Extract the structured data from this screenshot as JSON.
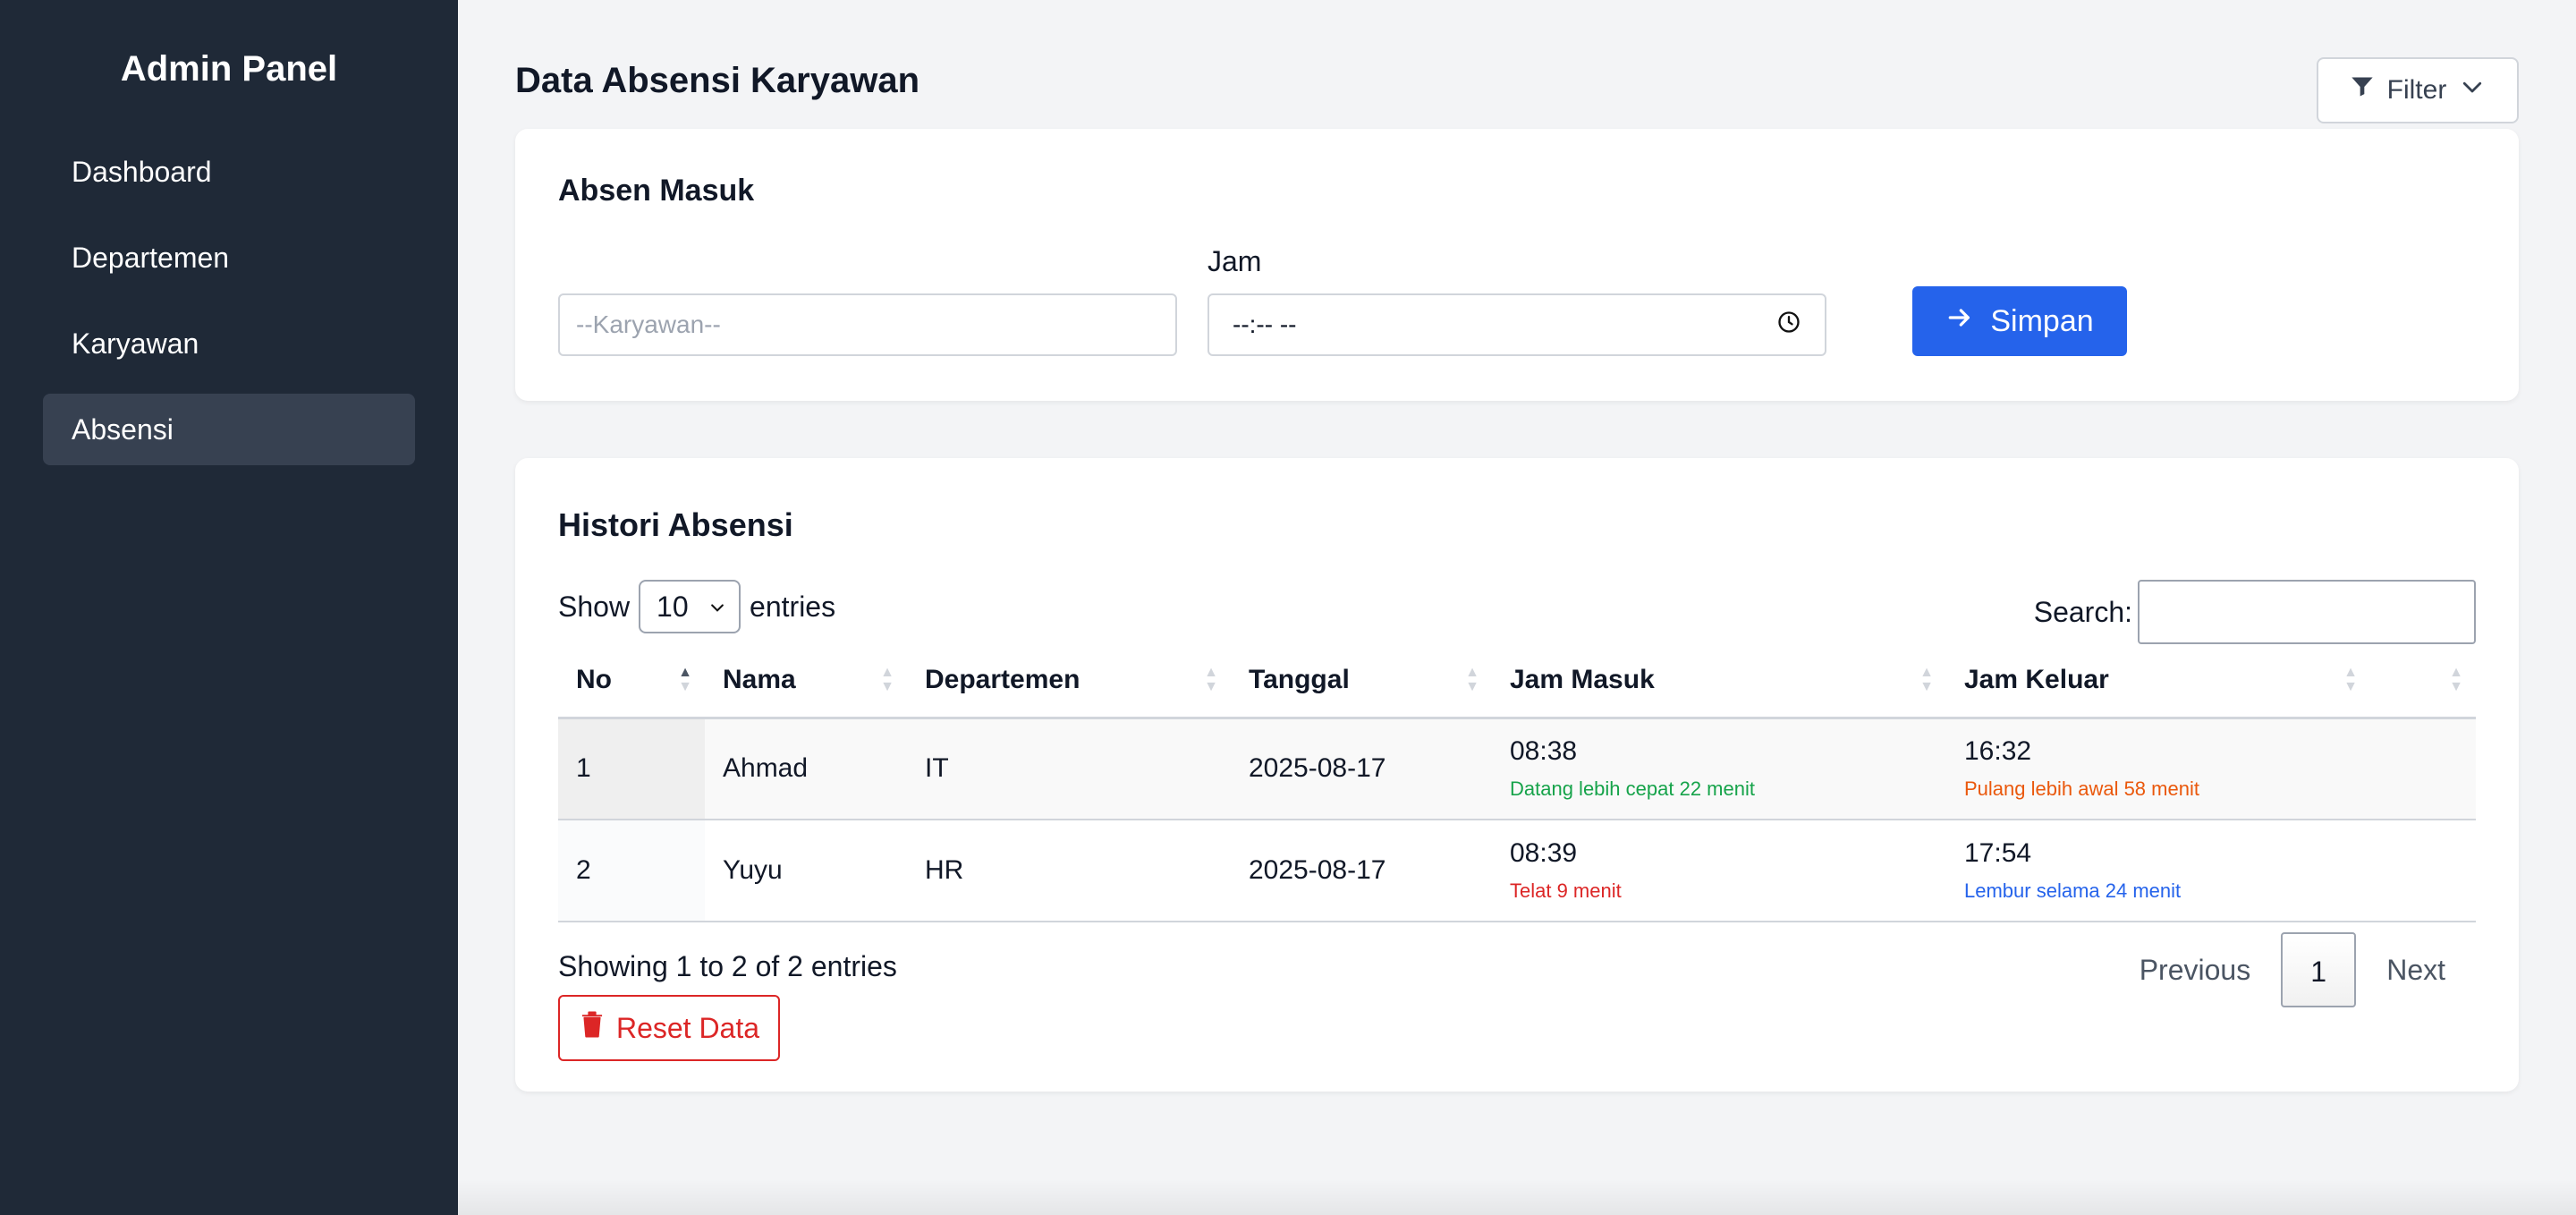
{
  "sidebar": {
    "brand": "Admin Panel",
    "items": [
      {
        "label": "Dashboard"
      },
      {
        "label": "Departemen"
      },
      {
        "label": "Karyawan"
      },
      {
        "label": "Absensi"
      }
    ]
  },
  "header": {
    "title": "Data Absensi Karyawan",
    "filter_label": "Filter"
  },
  "absen_masuk": {
    "title": "Absen Masuk",
    "employee_placeholder": "--Karyawan--",
    "time_label": "Jam",
    "time_value": "--:-- --",
    "submit_label": "Simpan"
  },
  "histori": {
    "title": "Histori Absensi",
    "show_label": "Show",
    "entries_value": "10",
    "entries_label": "entries",
    "search_label": "Search:",
    "columns": [
      "No",
      "Nama",
      "Departemen",
      "Tanggal",
      "Jam Masuk",
      "Jam Keluar"
    ],
    "rows": [
      {
        "no": "1",
        "nama": "Ahmad",
        "departemen": "IT",
        "tanggal": "2025-08-17",
        "jam_masuk": "08:38",
        "jam_masuk_note": "Datang lebih cepat 22 menit",
        "jam_keluar": "16:32",
        "jam_keluar_note": "Pulang lebih awal 58 menit"
      },
      {
        "no": "2",
        "nama": "Yuyu",
        "departemen": "HR",
        "tanggal": "2025-08-17",
        "jam_masuk": "08:39",
        "jam_masuk_note": "Telat 9 menit",
        "jam_keluar": "17:54",
        "jam_keluar_note": "Lembur selama 24 menit"
      }
    ],
    "showing_text": "Showing 1 to 2 of 2 entries",
    "pagination": {
      "previous": "Previous",
      "current": "1",
      "next": "Next"
    },
    "reset_label": "Reset Data"
  },
  "colors": {
    "sidebar_bg": "#1f2937",
    "primary": "#2563eb",
    "danger": "#dc2626",
    "note_early": "#16a34a",
    "note_late": "#dc2626",
    "note_leave_early": "#ea580c",
    "note_overtime": "#2563eb"
  }
}
